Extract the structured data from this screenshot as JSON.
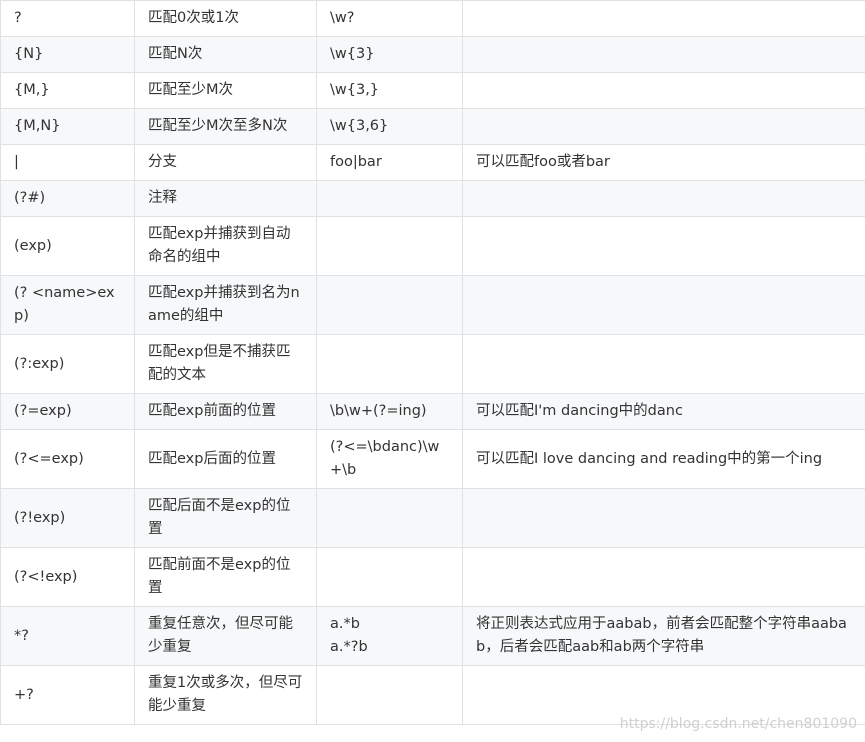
{
  "rows": [
    {
      "syntax": "?",
      "desc": "匹配0次或1次",
      "example": "\\w?",
      "note": ""
    },
    {
      "syntax": "{N}",
      "desc": "匹配N次",
      "example": "\\w{3}",
      "note": ""
    },
    {
      "syntax": "{M,}",
      "desc": "匹配至少M次",
      "example": "\\w{3,}",
      "note": ""
    },
    {
      "syntax": "{M,N}",
      "desc": "匹配至少M次至多N次",
      "example": "\\w{3,6}",
      "note": ""
    },
    {
      "syntax": "|",
      "desc": "分支",
      "example": "foo|bar",
      "note": "可以匹配foo或者bar"
    },
    {
      "syntax": "(?#)",
      "desc": "注释",
      "example": "",
      "note": ""
    },
    {
      "syntax": "(exp)",
      "desc": "匹配exp并捕获到自动命名的组中",
      "example": "",
      "note": ""
    },
    {
      "syntax": "(? <name>exp)",
      "desc": "匹配exp并捕获到名为name的组中",
      "example": "",
      "note": ""
    },
    {
      "syntax": "(?:exp)",
      "desc": "匹配exp但是不捕获匹配的文本",
      "example": "",
      "note": ""
    },
    {
      "syntax": "(?=exp)",
      "desc": "匹配exp前面的位置",
      "example": "\\b\\w+(?=ing)",
      "note": "可以匹配I'm dancing中的danc"
    },
    {
      "syntax": "(?<=exp)",
      "desc": "匹配exp后面的位置",
      "example": "(?<=\\bdanc)\\w+\\b",
      "note": "可以匹配I love dancing and reading中的第一个ing"
    },
    {
      "syntax": "(?!exp)",
      "desc": "匹配后面不是exp的位置",
      "example": "",
      "note": ""
    },
    {
      "syntax": "(?<!exp)",
      "desc": "匹配前面不是exp的位置",
      "example": "",
      "note": ""
    },
    {
      "syntax": "*?",
      "desc": "重复任意次，但尽可能少重复",
      "example": "a.*b\na.*?b",
      "note": "将正则表达式应用于aabab，前者会匹配整个字符串aabab，后者会匹配aab和ab两个字符串"
    },
    {
      "syntax": "+?",
      "desc": "重复1次或多次，但尽可能少重复",
      "example": "",
      "note": ""
    }
  ],
  "watermark": "https://blog.csdn.net/chen801090"
}
